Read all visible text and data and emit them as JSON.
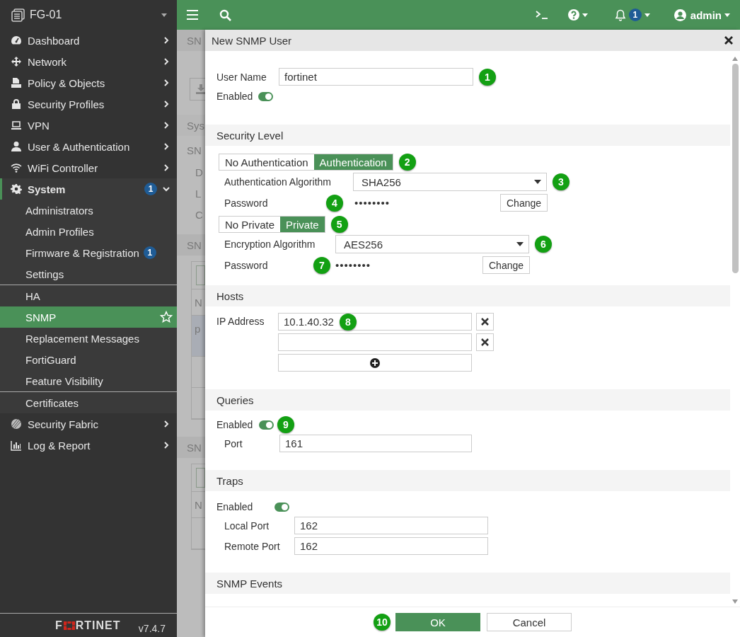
{
  "sidebar": {
    "device": "FG-01",
    "items": [
      {
        "label": "Dashboard",
        "expanded": false
      },
      {
        "label": "Network",
        "expanded": false
      },
      {
        "label": "Policy & Objects",
        "expanded": false
      },
      {
        "label": "Security Profiles",
        "expanded": false
      },
      {
        "label": "VPN",
        "expanded": false
      },
      {
        "label": "User & Authentication",
        "expanded": false
      },
      {
        "label": "WiFi Controller",
        "expanded": false
      },
      {
        "label": "System",
        "expanded": true,
        "badge": "1",
        "sections": [
          {
            "children": [
              {
                "label": "Administrators",
                "selected": false
              },
              {
                "label": "Admin Profiles",
                "selected": false
              },
              {
                "label": "Firmware & Registration",
                "selected": false,
                "badge": "1"
              },
              {
                "label": "Settings",
                "selected": false
              }
            ]
          },
          {
            "children": [
              {
                "label": "HA",
                "selected": false
              },
              {
                "label": "SNMP",
                "selected": true
              },
              {
                "label": "Replacement Messages",
                "selected": false
              },
              {
                "label": "FortiGuard",
                "selected": false
              },
              {
                "label": "Feature Visibility",
                "selected": false
              }
            ]
          },
          {
            "children": [
              {
                "label": "Certificates",
                "selected": false
              }
            ]
          }
        ]
      },
      {
        "label": "Security Fabric",
        "expanded": false
      },
      {
        "label": "Log & Report",
        "expanded": false
      }
    ],
    "logo_left": "F",
    "logo_right": "RTINET",
    "version": "v7.4.7"
  },
  "topbar": {
    "notifications": "1",
    "user": "admin"
  },
  "background_page": [
    {
      "kind": "bar",
      "text": "SN"
    },
    {
      "kind": "tool"
    },
    {
      "kind": "band",
      "text": "Sys"
    },
    {
      "kind": "heading",
      "text": "SN"
    },
    {
      "kind": "field",
      "text": "D"
    },
    {
      "kind": "field",
      "text": "L"
    },
    {
      "kind": "field",
      "text": "C"
    },
    {
      "kind": "bar",
      "text": "SN"
    },
    {
      "kind": "table",
      "header": "N",
      "rows": [
        {
          "text": "p",
          "selected": true
        },
        {
          "selected": false
        },
        {
          "selected": false
        }
      ]
    },
    {
      "kind": "bar",
      "text": "SN"
    },
    {
      "kind": "table",
      "header": "N",
      "rows": [
        {
          "selected": false
        }
      ]
    }
  ],
  "dialog": {
    "title": "New SNMP User",
    "user_name": {
      "label": "User Name",
      "value": "fortinet",
      "callout": "1"
    },
    "enabled": {
      "label": "Enabled",
      "on": true
    },
    "sections": [
      {
        "kind": "security",
        "title": "Security Level",
        "groups": [
          {
            "options": [
              {
                "label": "No Authentication",
                "selected": false
              },
              {
                "label": "Authentication",
                "selected": true
              }
            ],
            "callout": "2",
            "algorithm": {
              "label": "Authentication Algorithm",
              "value": "SHA256",
              "callout": "3"
            },
            "password": {
              "label": "Password",
              "value": "••••••••",
              "callout": "4",
              "button": "Change"
            }
          },
          {
            "options": [
              {
                "label": "No Private",
                "selected": false
              },
              {
                "label": "Private",
                "selected": true
              }
            ],
            "callout": "5",
            "algorithm": {
              "label": "Encryption Algorithm",
              "value": "AES256",
              "callout": "6"
            },
            "password": {
              "label": "Password",
              "value": "••••••••",
              "callout": "7",
              "button": "Change"
            }
          }
        ]
      },
      {
        "kind": "hosts",
        "title": "Hosts",
        "label": "IP Address",
        "hosts": [
          {
            "kind": "entry",
            "value": "10.1.40.32",
            "callout": "8"
          },
          {
            "kind": "blank"
          }
        ]
      },
      {
        "kind": "toggle_fields",
        "title": "Queries",
        "enabled": {
          "label": "Enabled",
          "on": true,
          "callout": "9"
        },
        "fields": [
          {
            "label": "Port",
            "value": "161"
          }
        ]
      },
      {
        "kind": "toggle_fields",
        "title": "Traps",
        "enabled": {
          "label": "Enabled",
          "on": true
        },
        "fields": [
          {
            "label": "Local Port",
            "value": "162"
          },
          {
            "label": "Remote Port",
            "value": "162"
          }
        ]
      },
      {
        "kind": "header_only",
        "title": "SNMP Events"
      }
    ],
    "buttons": [
      {
        "label": "OK",
        "primary": true,
        "callout": "10"
      },
      {
        "label": "Cancel",
        "primary": false
      }
    ]
  }
}
